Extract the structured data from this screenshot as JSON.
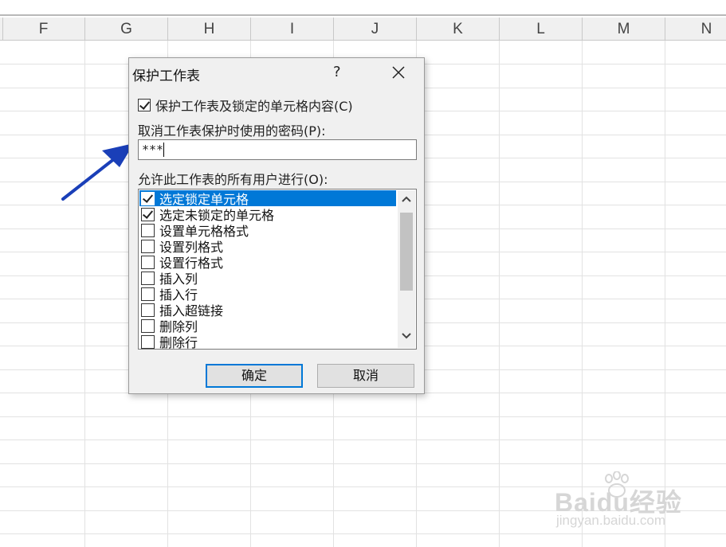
{
  "columns": [
    "F",
    "G",
    "H",
    "I",
    "J",
    "K",
    "L",
    "M",
    "N"
  ],
  "dialog": {
    "title": "保护工作表",
    "help": "?",
    "protect_label": "保护工作表及锁定的单元格内容(C)",
    "protect_checked": true,
    "password_label": "取消工作表保护时使用的密码(P):",
    "password_value": "***",
    "allow_label": "允许此工作表的所有用户进行(O):",
    "list_items": [
      {
        "label": "选定锁定单元格",
        "checked": true,
        "selected": true
      },
      {
        "label": "选定未锁定的单元格",
        "checked": true,
        "selected": false
      },
      {
        "label": "设置单元格格式",
        "checked": false,
        "selected": false
      },
      {
        "label": "设置列格式",
        "checked": false,
        "selected": false
      },
      {
        "label": "设置行格式",
        "checked": false,
        "selected": false
      },
      {
        "label": "插入列",
        "checked": false,
        "selected": false
      },
      {
        "label": "插入行",
        "checked": false,
        "selected": false
      },
      {
        "label": "插入超链接",
        "checked": false,
        "selected": false
      },
      {
        "label": "删除列",
        "checked": false,
        "selected": false
      },
      {
        "label": "删除行",
        "checked": false,
        "selected": false
      }
    ],
    "ok_label": "确定",
    "cancel_label": "取消"
  },
  "watermark": {
    "brand": "Baidu经验",
    "url": "jingyan.baidu.com"
  },
  "colors": {
    "accent": "#0078d7",
    "arrow": "#1a3fb8"
  },
  "icons": {
    "close": "close-icon",
    "scroll_up": "chevron-up-icon",
    "scroll_down": "chevron-down-icon"
  }
}
